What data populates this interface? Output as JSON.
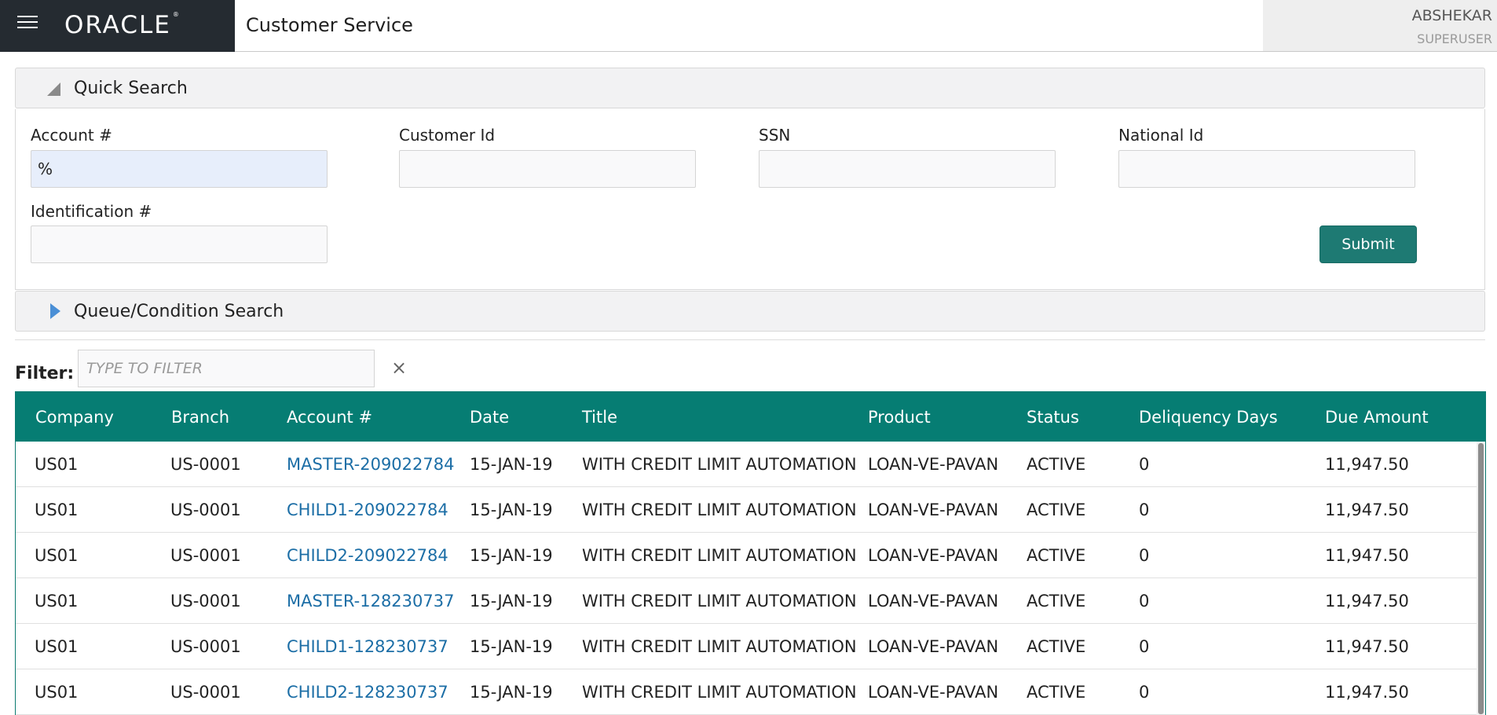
{
  "header": {
    "logo_text": "ORACLE",
    "app_title": "Customer Service",
    "user_name": "ABSHEKAR",
    "user_role": "SUPERUSER"
  },
  "quick_search": {
    "title": "Quick Search",
    "fields": {
      "account_label": "Account #",
      "account_value": "%",
      "customer_id_label": "Customer Id",
      "ssn_label": "SSN",
      "national_id_label": "National Id",
      "identification_label": "Identification #"
    },
    "submit_label": "Submit"
  },
  "queue_search": {
    "title": "Queue/Condition Search"
  },
  "filter": {
    "label": "Filter:",
    "placeholder": "TYPE TO FILTER",
    "clear_icon": "×"
  },
  "table": {
    "columns": [
      "Company",
      "Branch",
      "Account #",
      "Date",
      "Title",
      "Product",
      "Status",
      "Deliquency Days",
      "Due Amount"
    ],
    "rows": [
      [
        "US01",
        "US-0001",
        "MASTER-209022784",
        "15-JAN-19",
        "WITH CREDIT LIMIT AUTOMATION",
        "LOAN-VE-PAVAN",
        "ACTIVE",
        "0",
        "11,947.50"
      ],
      [
        "US01",
        "US-0001",
        "CHILD1-209022784",
        "15-JAN-19",
        "WITH CREDIT LIMIT AUTOMATION",
        "LOAN-VE-PAVAN",
        "ACTIVE",
        "0",
        "11,947.50"
      ],
      [
        "US01",
        "US-0001",
        "CHILD2-209022784",
        "15-JAN-19",
        "WITH CREDIT LIMIT AUTOMATION",
        "LOAN-VE-PAVAN",
        "ACTIVE",
        "0",
        "11,947.50"
      ],
      [
        "US01",
        "US-0001",
        "MASTER-128230737",
        "15-JAN-19",
        "WITH CREDIT LIMIT AUTOMATION",
        "LOAN-VE-PAVAN",
        "ACTIVE",
        "0",
        "11,947.50"
      ],
      [
        "US01",
        "US-0001",
        "CHILD1-128230737",
        "15-JAN-19",
        "WITH CREDIT LIMIT AUTOMATION",
        "LOAN-VE-PAVAN",
        "ACTIVE",
        "0",
        "11,947.50"
      ],
      [
        "US01",
        "US-0001",
        "CHILD2-128230737",
        "15-JAN-19",
        "WITH CREDIT LIMIT AUTOMATION",
        "LOAN-VE-PAVAN",
        "ACTIVE",
        "0",
        "11,947.50"
      ]
    ]
  },
  "colors": {
    "brand_bg": "#252b31",
    "table_header": "#067d73",
    "submit_button": "#1e7a73",
    "link": "#1c6ea6"
  }
}
